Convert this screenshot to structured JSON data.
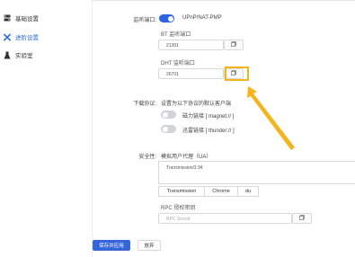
{
  "sidebar": {
    "items": [
      {
        "label": "基础设置",
        "icon": "settings-icon",
        "active": false
      },
      {
        "label": "进阶设置",
        "icon": "tools-icon",
        "active": true
      },
      {
        "label": "实验室",
        "icon": "flask-icon",
        "active": false
      }
    ]
  },
  "listen_port": {
    "label": "监听端口:",
    "upnp_label": "UPnP/NAT-PMP",
    "upnp_enabled": true,
    "bt_label": "BT 监听端口",
    "bt_value": "21301",
    "dht_label": "DHT 监听端口",
    "dht_value": "26701"
  },
  "download_protocol": {
    "label": "下载协议:",
    "description": "设置为以下协议的默认客户端",
    "magnet_label": "磁力链接 [ magnet:// ]",
    "magnet_enabled": false,
    "thunder_label": "迅雷链接 [ thunder:// ]",
    "thunder_enabled": false
  },
  "security": {
    "label": "安全性:",
    "ua_label": "模拟用户代理（UA）",
    "ua_value": "Transmission/2.94",
    "presets": [
      "Transmission",
      "Chrome",
      "du"
    ],
    "rpc_label": "RPC 授权密钥",
    "rpc_placeholder": "RPC Secret"
  },
  "actions": {
    "save_label": "保存并应用",
    "discard_label": "放弃"
  },
  "colors": {
    "accent": "#2d63e2",
    "annotation": "#f5b31c"
  }
}
